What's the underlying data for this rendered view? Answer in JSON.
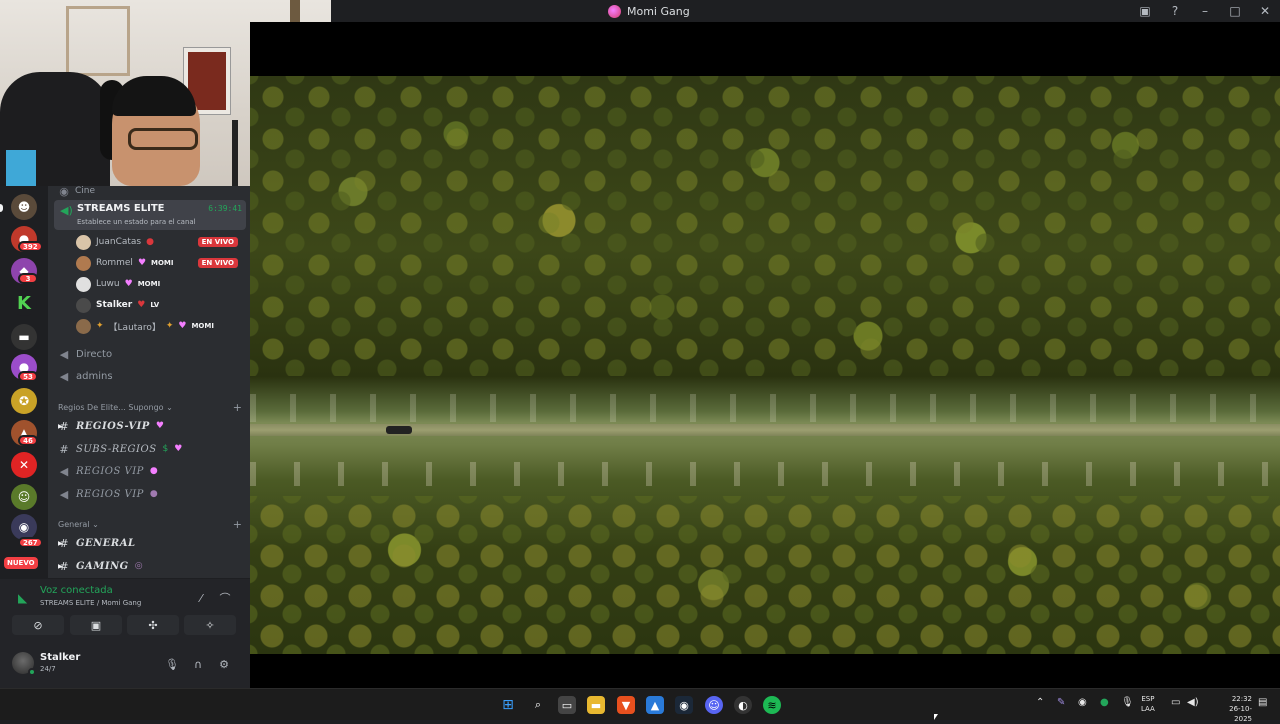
{
  "window": {
    "title": "Momi Gang"
  },
  "titlebar_icons": [
    "inbox-icon",
    "help-icon",
    "minimize-icon",
    "maximize-icon",
    "close-icon"
  ],
  "server_badges": [
    "392",
    "3",
    "53",
    "46",
    "267"
  ],
  "server_new_label": "NUEVO",
  "voice_channel": {
    "above_label": "Cine",
    "name": "STREAMS ELITE",
    "timer": "6:39:41",
    "status_prompt": "Establece un estado para el canal"
  },
  "members": [
    {
      "name": "JuanCatas",
      "tag": "",
      "live": "EN VIVO",
      "avatar_color": "#d9c4a8"
    },
    {
      "name": "Rommel",
      "tag": "MOMI",
      "live": "EN VIVO",
      "avatar_color": "#b07a4f"
    },
    {
      "name": "Luwu",
      "tag": "MOMI",
      "live": "",
      "avatar_color": "#e0e0e0"
    },
    {
      "name": "Stalker",
      "tag": "LV",
      "live": "",
      "avatar_color": "#4a4a4a"
    },
    {
      "name": "【Lautaro】",
      "tag": "MOMI",
      "live": "",
      "avatar_color": "#8a6a4a"
    }
  ],
  "channels_top": [
    "Directo",
    "admins"
  ],
  "category_1": "Regios De Elite... Supongo",
  "category_1_channels": [
    "REGIOS-VIP",
    "SUBS-REGIOS",
    "REGIOS VIP",
    "REGIOS VIP"
  ],
  "category_2": "General",
  "category_2_channels": [
    "GENERAL",
    "GAMING"
  ],
  "voice_panel": {
    "title": "Voz conectada",
    "subtitle": "STREAMS ELITE / Momi Gang"
  },
  "user": {
    "name": "Stalker",
    "status": "24/7"
  },
  "taskbar": {
    "lang_line1": "ESP",
    "lang_line2": "LAA",
    "time": "22:32",
    "date": "26-10-2025"
  },
  "colors": {
    "accent_green": "#23a55a",
    "live_red": "#da373c",
    "discord_bg": "#2b2d31"
  }
}
